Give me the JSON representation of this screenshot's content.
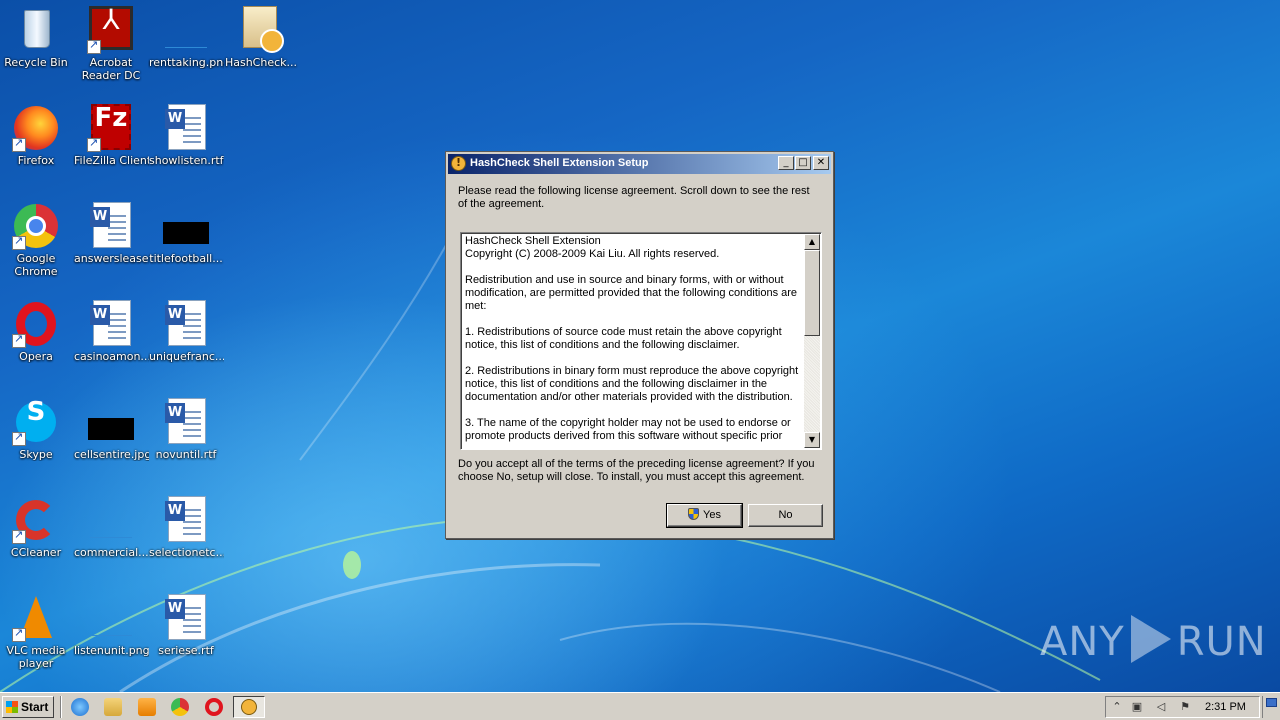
{
  "desktop": {
    "icons": [
      {
        "label": "Recycle Bin",
        "name": "recycle-bin-icon"
      },
      {
        "label": "Acrobat Reader DC",
        "name": "acrobat-reader-icon"
      },
      {
        "label": "renttaking.png",
        "name": "png-file-icon"
      },
      {
        "label": "HashCheck...",
        "name": "setup-file-icon"
      },
      {
        "label": "Firefox",
        "name": "firefox-icon"
      },
      {
        "label": "FileZilla Client",
        "name": "filezilla-icon"
      },
      {
        "label": "showlisten.rtf",
        "name": "word-document-icon"
      },
      {
        "label": "Google Chrome",
        "name": "chrome-icon"
      },
      {
        "label": "answerslease...",
        "name": "word-document-icon"
      },
      {
        "label": "titlefootball...",
        "name": "image-file-icon"
      },
      {
        "label": "Opera",
        "name": "opera-icon"
      },
      {
        "label": "casinoamon...",
        "name": "word-document-icon"
      },
      {
        "label": "uniquefranc...",
        "name": "word-document-icon"
      },
      {
        "label": "Skype",
        "name": "skype-icon"
      },
      {
        "label": "cellsentire.jpg",
        "name": "image-file-icon"
      },
      {
        "label": "novuntil.rtf",
        "name": "word-document-icon"
      },
      {
        "label": "CCleaner",
        "name": "ccleaner-icon"
      },
      {
        "label": "commercial...",
        "name": "image-file-icon"
      },
      {
        "label": "selectionetc...",
        "name": "word-document-icon"
      },
      {
        "label": "VLC media player",
        "name": "vlc-icon"
      },
      {
        "label": "listenunit.png",
        "name": "png-file-icon"
      },
      {
        "label": "seriese.rtf",
        "name": "word-document-icon"
      }
    ]
  },
  "dialog": {
    "title": "HashCheck Shell Extension Setup",
    "intro": "Please read the following license agreement. Scroll down to see the rest of the agreement.",
    "license": {
      "line1": "HashCheck Shell Extension",
      "line2": "Copyright (C) 2008-2009 Kai Liu.  All rights reserved.",
      "para1": "Redistribution and use in source and binary forms, with or without modification, are permitted provided that the following conditions are met:",
      "para2": "1. Redistributions of source code must retain the above copyright notice, this list of conditions and the following disclaimer.",
      "para3": "2. Redistributions in binary form must reproduce the above copyright notice, this list of conditions and the following disclaimer in the documentation and/or other materials provided with the distribution.",
      "para4": "3. The name of the copyright holder may not be used to endorse or promote products derived from this software without specific prior"
    },
    "question": "Do you accept all of the terms of the preceding license agreement? If you choose No, setup will close. To install, you must accept this agreement.",
    "yes_label": "Yes",
    "no_label": "No",
    "minimize_glyph": "_",
    "maximize_glyph": "□",
    "close_glyph": "✕"
  },
  "taskbar": {
    "start_label": "Start",
    "clock": "2:31 PM"
  },
  "watermark": {
    "left": "ANY",
    "right": "RUN"
  }
}
